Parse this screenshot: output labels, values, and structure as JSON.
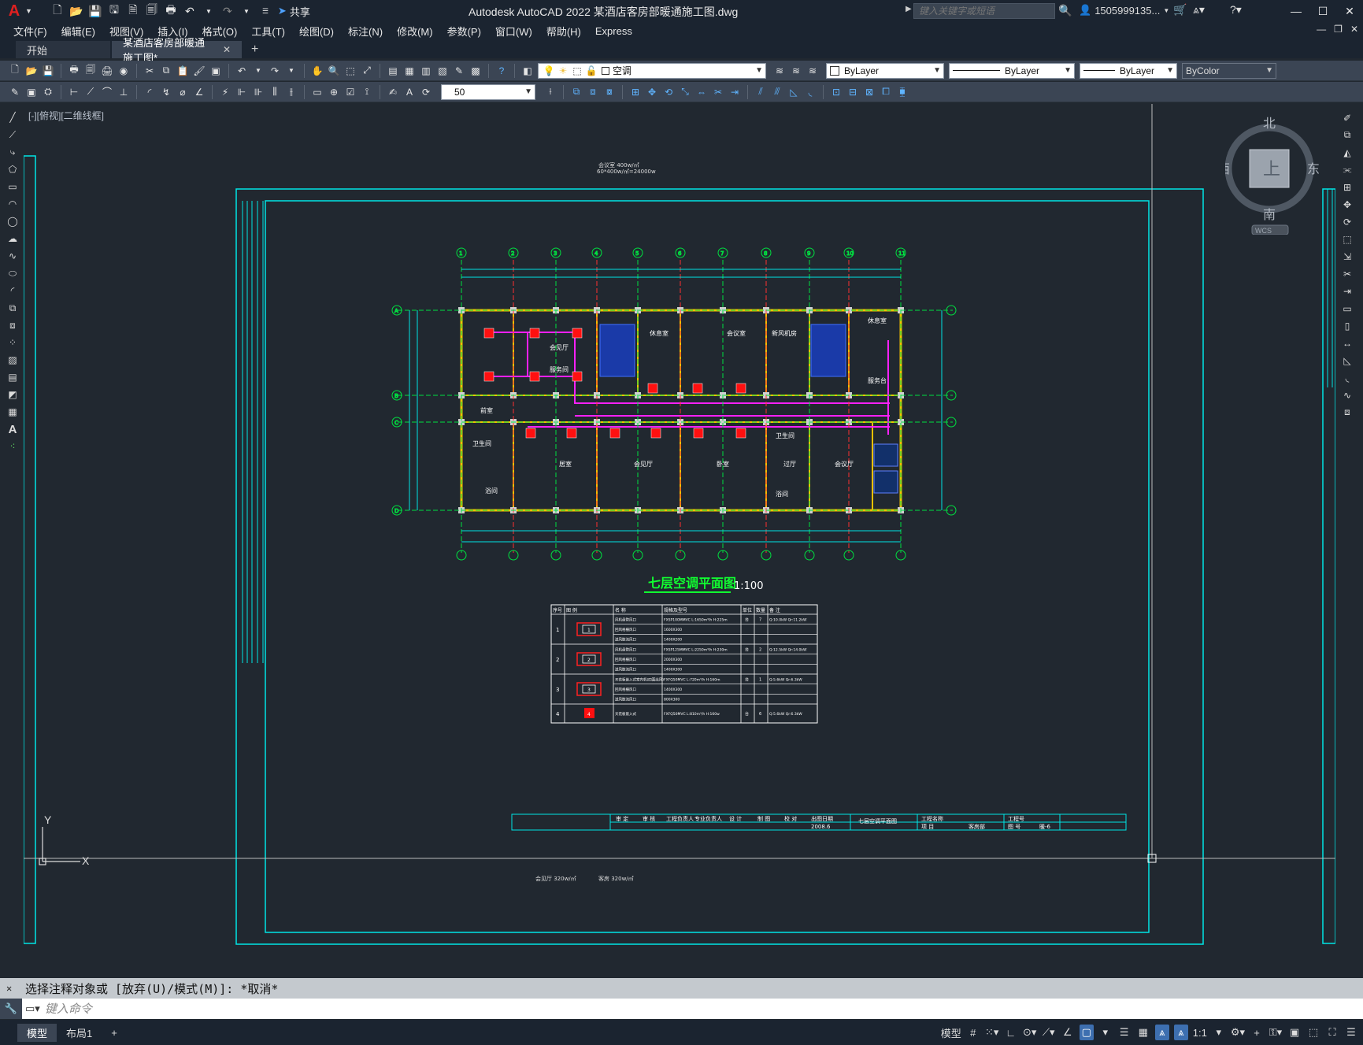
{
  "app": {
    "title": "Autodesk AutoCAD 2022    某酒店客房部暖通施工图.dwg",
    "share_label": "共享",
    "search_placeholder": "键入关键字或短语",
    "user": "1505999135...",
    "logo": "A"
  },
  "menus": [
    "文件(F)",
    "编辑(E)",
    "视图(V)",
    "插入(I)",
    "格式(O)",
    "工具(T)",
    "绘图(D)",
    "标注(N)",
    "修改(M)",
    "参数(P)",
    "窗口(W)",
    "帮助(H)",
    "Express"
  ],
  "tabs": {
    "start": "开始",
    "active": "某酒店客房部暖通施工图*"
  },
  "layer": {
    "current": "空调"
  },
  "properties": {
    "color": "ByLayer",
    "linetype": "ByLayer",
    "lineweight": "ByLayer",
    "plotstyle": "ByColor"
  },
  "dimscale": "50",
  "viewport_label": "[-][俯视][二维线框]",
  "viewcube": {
    "north": "北",
    "south": "南",
    "east": "东",
    "west": "西",
    "face": "上",
    "wcs": "WCS"
  },
  "drawing": {
    "title": "七层空调平面图",
    "scale": "1:100",
    "top_note_1": "会议室 400w/㎡",
    "top_note_2": "60*400w/㎡=24000w",
    "bottom_note_1": "会见厅 320w/㎡",
    "bottom_note_2": "客房 320w/㎡",
    "rooms": [
      "休息室",
      "会议室",
      "新风机房",
      "休息室",
      "会见厅",
      "服务间",
      "服务台",
      "前室",
      "卫生间",
      "居室",
      "会见厅",
      "卧室",
      "过厅",
      "卫生间",
      "会议厅",
      "浴间",
      "浴间"
    ],
    "grid_top": [
      "1",
      "2",
      "3",
      "4",
      "5",
      "6",
      "7",
      "8",
      "9",
      "10",
      "11"
    ],
    "grid_side": [
      "A",
      "B",
      "C",
      "D"
    ],
    "table": {
      "headers": [
        "序号",
        "图 例",
        "名 称",
        "规格及型号",
        "单位",
        "数量",
        "备 注"
      ],
      "rows": [
        {
          "no": "1",
          "items": [
            "风机盘管风口",
            "回风格栅风口",
            "送风散流风口"
          ],
          "specs": [
            "FXSP100MMVC L:1650m³/h H:225m",
            "1600X300",
            "1400X200"
          ],
          "unit": "台",
          "qty": "7",
          "note": "Q:10.0kW Qr:11.2kW"
        },
        {
          "no": "2",
          "items": [
            "风机盘管风口",
            "回风格栅风口",
            "送风散流风口"
          ],
          "specs": [
            "FXSP125MMVC L:2250m³/h H:230m",
            "2000X300",
            "1400X300"
          ],
          "unit": "台",
          "qty": "2",
          "note": "Q:12.5kW Qr:14.0kW"
        },
        {
          "no": "3",
          "items": [
            "天花板嵌入式室内机(四面出风)",
            "回风格栅风口",
            "送风散流风口"
          ],
          "specs": [
            "FXFQ50MVC L:720m³/h H:160m",
            "1400X300",
            "800X300"
          ],
          "unit": "台",
          "qty": "1",
          "note": "Q:5.6kW Qr:6.3kW"
        },
        {
          "no": "4",
          "items": [
            "天花板嵌入式"
          ],
          "specs": [
            "FXFQ50MVC L:810m³/h H:160w"
          ],
          "unit": "台",
          "qty": "6",
          "note": "Q:5.6kW Qr:6.3kW"
        }
      ]
    },
    "titleblock": [
      "审 定",
      "审 核",
      "工程负责人",
      "专业负责人",
      "设 计",
      "制 图",
      "校 对",
      "出图日期",
      "2008.6",
      "七层空调平面图",
      "工程名称",
      "项 目",
      "客房部",
      "工程号",
      "图 号",
      "暖-6"
    ]
  },
  "command": {
    "history": "选择注释对象或 [放弃(U)/模式(M)]: *取消*",
    "placeholder": "键入命令"
  },
  "layouts": [
    "模型",
    "布局1"
  ],
  "status": {
    "model_label": "模型",
    "annoscale": "1:1"
  },
  "colors": {
    "background": "#212830",
    "frame": "#00e5e5",
    "wall": "#f0c000",
    "grid": "#00e040",
    "duct": "#ff20ff",
    "unit": "#ff1010"
  }
}
